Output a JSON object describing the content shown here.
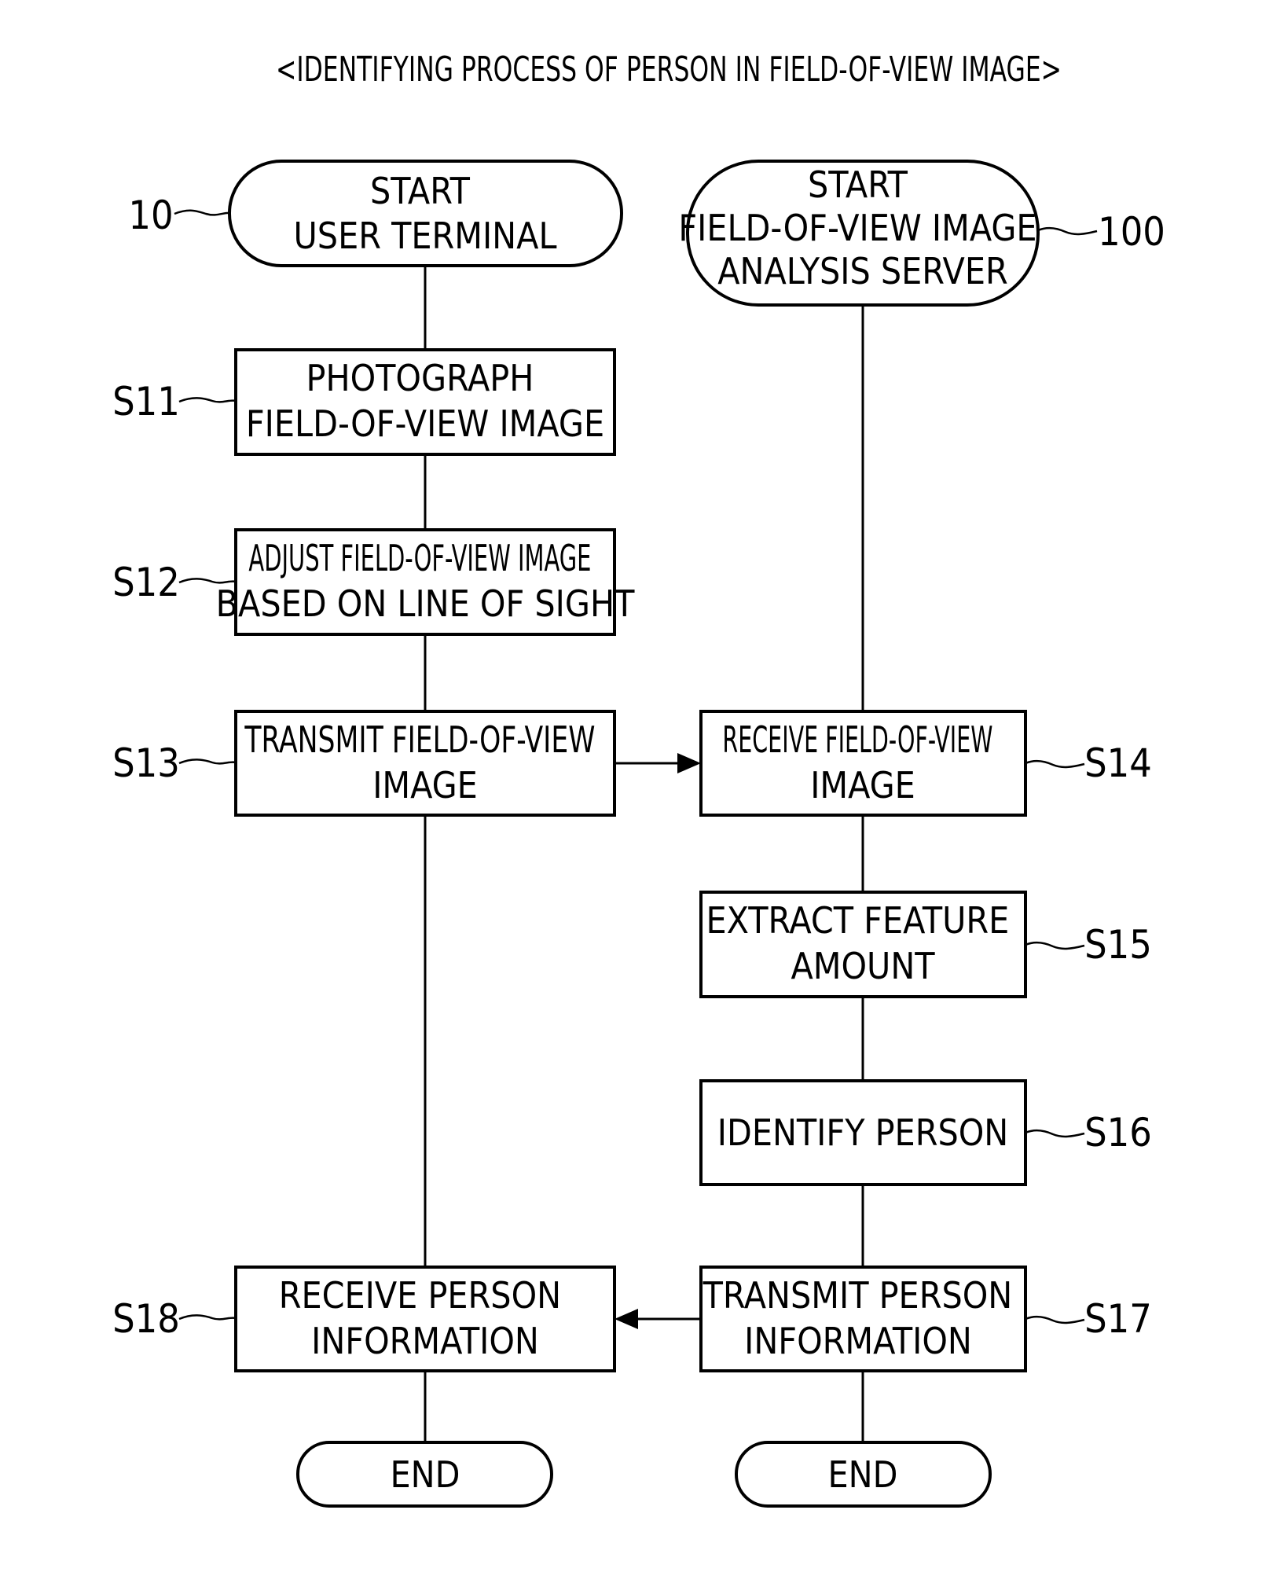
{
  "title": "<IDENTIFYING PROCESS OF PERSON IN FIELD-OF-VIEW IMAGE>",
  "lanes": {
    "left": {
      "ref": "10",
      "start_lines": [
        "START",
        "USER TERMINAL"
      ]
    },
    "right": {
      "ref": "100",
      "start_lines": [
        "START",
        "FIELD-OF-VIEW IMAGE",
        "ANALYSIS SERVER"
      ]
    }
  },
  "steps": {
    "s11": {
      "ref": "S11",
      "lines": [
        "PHOTOGRAPH",
        "FIELD-OF-VIEW IMAGE"
      ]
    },
    "s12": {
      "ref": "S12",
      "lines": [
        "ADJUST FIELD-OF-VIEW IMAGE",
        "BASED ON LINE OF SIGHT"
      ]
    },
    "s13": {
      "ref": "S13",
      "lines": [
        "TRANSMIT FIELD-OF-VIEW",
        "IMAGE"
      ]
    },
    "s14": {
      "ref": "S14",
      "lines": [
        "RECEIVE FIELD-OF-VIEW",
        "IMAGE"
      ]
    },
    "s15": {
      "ref": "S15",
      "lines": [
        "EXTRACT FEATURE",
        "AMOUNT"
      ]
    },
    "s16": {
      "ref": "S16",
      "lines": [
        "IDENTIFY PERSON"
      ]
    },
    "s17": {
      "ref": "S17",
      "lines": [
        "TRANSMIT PERSON",
        "INFORMATION"
      ]
    },
    "s18": {
      "ref": "S18",
      "lines": [
        "RECEIVE PERSON",
        "INFORMATION"
      ]
    }
  },
  "end_left": "END",
  "end_right": "END"
}
